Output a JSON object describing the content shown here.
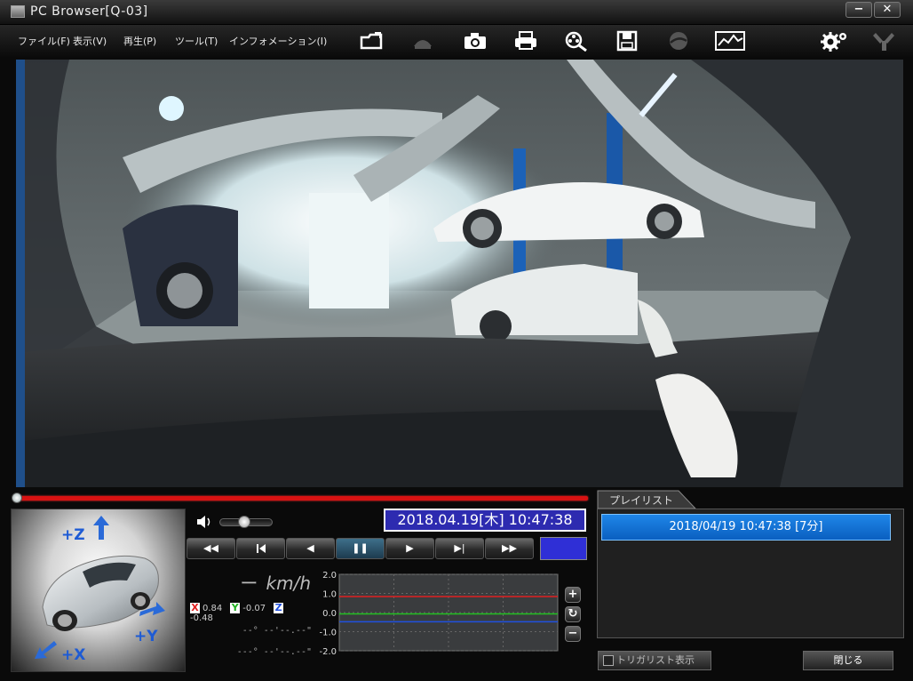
{
  "window": {
    "title": "PC Browser[Q-03]",
    "minimize": "−",
    "close": "✕"
  },
  "menu": [
    {
      "label": "ファイル(F)"
    },
    {
      "label": "表示(V)"
    },
    {
      "label": "再生(P)"
    },
    {
      "label": "ツール(T)"
    },
    {
      "label": "インフォメーション(I)"
    }
  ],
  "toolbar_icons": [
    "folder-open-icon",
    "export-disabled-icon",
    "camera-icon",
    "print-icon",
    "search-film-icon",
    "save-icon",
    "map-disabled-icon",
    "graph-map-icon",
    "settings-icon",
    "tool-disabled-icon"
  ],
  "axes": {
    "z": "+Z",
    "y": "+Y",
    "x": "+X"
  },
  "datetime": "2018.04.19[木] 10:47:38",
  "controls": {
    "rewind": "◀◀",
    "prev": "▶|",
    "back": "◀",
    "pause": "❚❚",
    "play": "▶",
    "next": "▶|",
    "forward": "▶▶"
  },
  "speed": {
    "value": "ー",
    "unit": "km/h"
  },
  "gsensor": {
    "x_key": "X",
    "x_val": "0.84",
    "y_key": "Y",
    "y_val": "-0.07",
    "z_key": "Z",
    "z_val": "-0.48"
  },
  "coords": {
    "lat": "--°  --'--.--\"",
    "lon": "---°  --'--.--\""
  },
  "chart_data": {
    "type": "line",
    "yticks": [
      "2.0",
      "1.0",
      "0.0",
      "-1.0",
      "-2.0"
    ],
    "ylim": [
      -2.0,
      2.0
    ],
    "series": [
      {
        "color": "#e02020",
        "values": [
          0.84,
          0.84
        ]
      },
      {
        "color": "#20c020",
        "values": [
          -0.07,
          -0.07
        ]
      },
      {
        "color": "#2050e0",
        "values": [
          -0.48,
          -0.48
        ]
      }
    ],
    "grid": true
  },
  "chart_buttons": {
    "zoom_in": "+",
    "reset": "↻",
    "zoom_out": "−"
  },
  "playlist": {
    "tab": "プレイリスト",
    "items": [
      "2018/04/19 10:47:38 [7分]"
    ]
  },
  "trigger_label": "トリガリスト表示",
  "close_label": "閉じる",
  "colors": {
    "accent": "#2d2bb0",
    "seek": "#d81212",
    "playlist_sel": "#1f86e8"
  }
}
